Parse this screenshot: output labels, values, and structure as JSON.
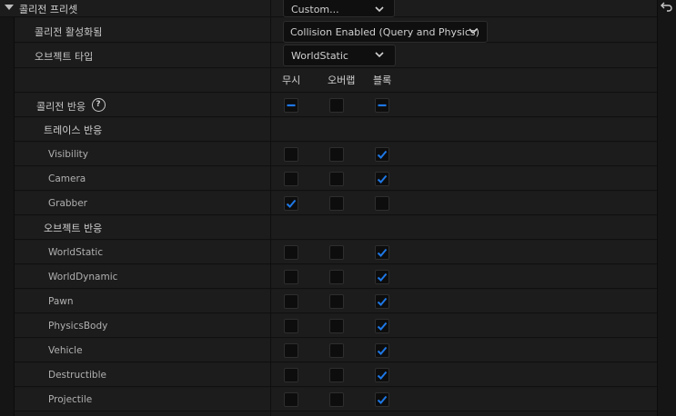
{
  "preset": {
    "label": "콜리전 프리셋",
    "value": "Custom..."
  },
  "collision_enabled": {
    "label": "콜리전 활성화됨",
    "value": "Collision Enabled (Query and Physics)"
  },
  "object_type": {
    "label": "오브젝트 타입",
    "value": "WorldStatic"
  },
  "columns": {
    "ignore": "무시",
    "overlap": "오버랩",
    "block": "블록"
  },
  "collision_response": {
    "label": "콜리전 반응",
    "help_glyph": "?",
    "state": [
      "mixed",
      "none",
      "mixed"
    ]
  },
  "trace_section": {
    "label": "트레이스 반응"
  },
  "trace_rows": [
    {
      "label": "Visibility",
      "state": "block"
    },
    {
      "label": "Camera",
      "state": "block"
    },
    {
      "label": "Grabber",
      "state": "ignore"
    }
  ],
  "object_section": {
    "label": "오브젝트 반응"
  },
  "object_rows": [
    {
      "label": "WorldStatic",
      "state": "block"
    },
    {
      "label": "WorldDynamic",
      "state": "block"
    },
    {
      "label": "Pawn",
      "state": "block"
    },
    {
      "label": "PhysicsBody",
      "state": "block"
    },
    {
      "label": "Vehicle",
      "state": "block"
    },
    {
      "label": "Destructible",
      "state": "block"
    },
    {
      "label": "Projectile",
      "state": "block"
    }
  ],
  "colors": {
    "accent": "#1e78e6",
    "panel": "#1c1c1c",
    "input": "#0f0f0f"
  }
}
